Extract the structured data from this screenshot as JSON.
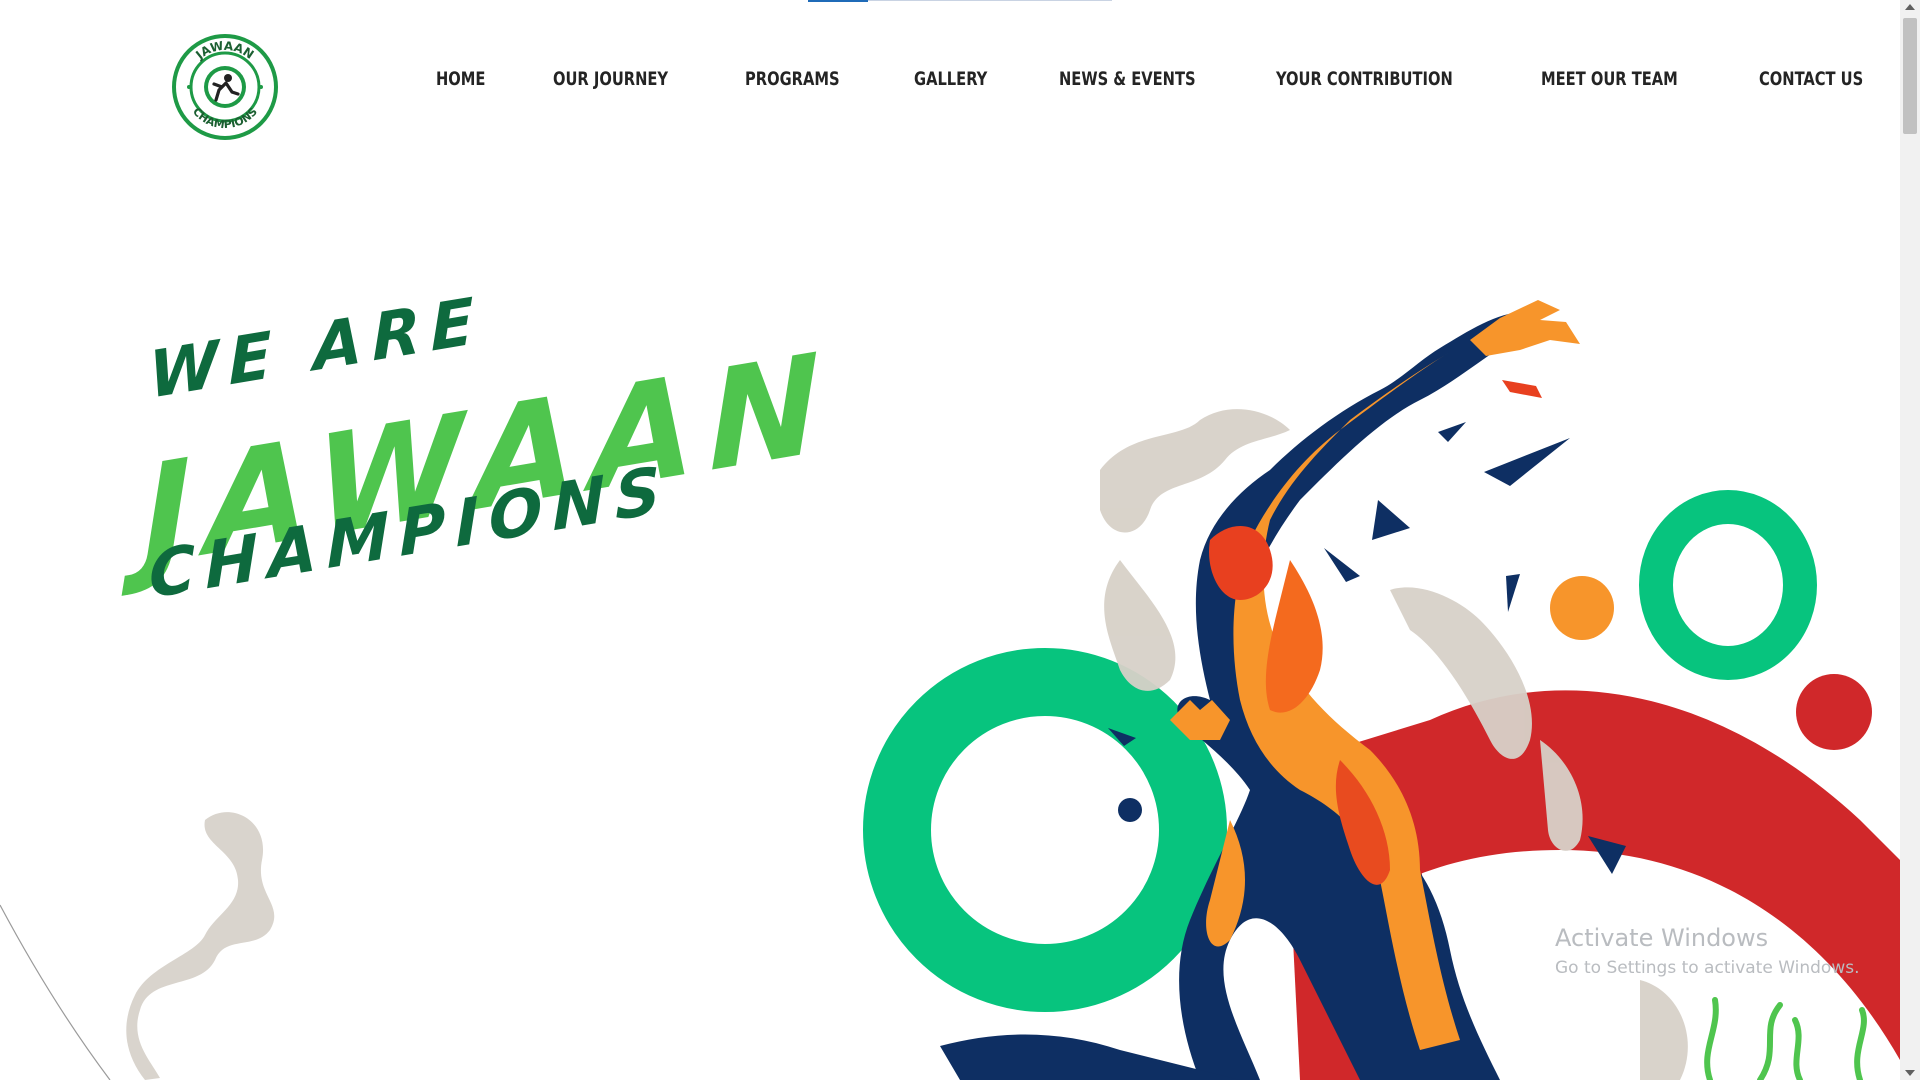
{
  "brand": {
    "logo_top_text": "JAWAAN",
    "logo_bottom_text": "CHAMPIONS",
    "colors": {
      "green": "#1e9a46",
      "light_green": "#4fc54e",
      "dark_green": "#0e6a3e"
    }
  },
  "nav": {
    "items": [
      {
        "label": "HOME"
      },
      {
        "label": "OUR JOURNEY"
      },
      {
        "label": "PROGRAMS"
      },
      {
        "label": "GALLERY"
      },
      {
        "label": "NEWS & EVENTS"
      },
      {
        "label": "YOUR CONTRIBUTION"
      },
      {
        "label": "MEET OUR TEAM"
      },
      {
        "label": "CONTACT US"
      }
    ]
  },
  "hero": {
    "line1": "WE ARE",
    "line2": "JAWAAN",
    "line3": "CHAMPIONS",
    "illustration": "athlete-illustration"
  },
  "watermark": {
    "title": "Activate Windows",
    "subtitle": "Go to Settings to activate Windows."
  }
}
